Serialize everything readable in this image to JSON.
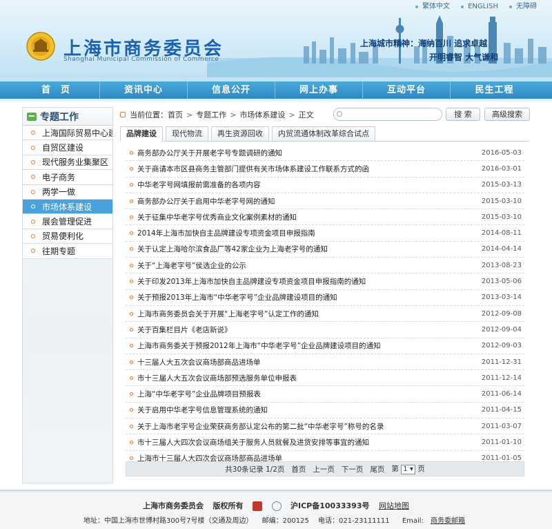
{
  "topbar": {
    "traditional": "繁体中文",
    "english": "ENGLISH",
    "accessibility": "无障碍"
  },
  "header": {
    "title": "上海市商务委员会",
    "subtitle": "Shanghai Municipal Commission of Commerce",
    "spirit_line1": "上海城市精神：海纳百川   追求卓越",
    "spirit_line2": "开明睿智   大气谦和"
  },
  "nav": [
    "首　页",
    "资讯中心",
    "信息公开",
    "网上办事",
    "互动平台",
    "民生工程"
  ],
  "sidebar": {
    "title": "专题工作",
    "items": [
      {
        "label": "上海国际贸易中心建设",
        "active": false
      },
      {
        "label": "自贸区建设",
        "active": false
      },
      {
        "label": "现代服务业集聚区",
        "active": false
      },
      {
        "label": "电子商务",
        "active": false
      },
      {
        "label": "两学一做",
        "active": false
      },
      {
        "label": "市场体系建设",
        "active": true
      },
      {
        "label": "展会管理促进",
        "active": false
      },
      {
        "label": "贸易便利化",
        "active": false
      },
      {
        "label": "往期专题",
        "active": false
      }
    ]
  },
  "breadcrumb": {
    "prefix": "当前位置：",
    "items": [
      "首页",
      "专题工作",
      "市场体系建设",
      "正文"
    ]
  },
  "search": {
    "placeholder": "",
    "button": "搜 索",
    "advanced": "高级搜索"
  },
  "tabs": [
    {
      "label": "品牌建设",
      "active": true
    },
    {
      "label": "现代物流",
      "active": false
    },
    {
      "label": "再生资源回收",
      "active": false
    },
    {
      "label": "内贸流通体制改革综合试点",
      "active": false
    }
  ],
  "articles": [
    {
      "title": "商务部办公厅关于开展老字号专题调研的通知",
      "date": "2016-05-03"
    },
    {
      "title": "关于商请本市区县商务主管部门提供有关市场体系建设工作联系方式的函",
      "date": "2016-03-01"
    },
    {
      "title": "中华老字号网填报前需准备的各项内容",
      "date": "2015-03-13"
    },
    {
      "title": "商务部办公厅关于启用中华老字号网的通知",
      "date": "2015-03-10"
    },
    {
      "title": "关于征集中华老字号优秀商业文化案例素材的通知",
      "date": "2015-03-10"
    },
    {
      "title": "2014年上海市加快自主品牌建设专项资金项目申报指南",
      "date": "2014-08-11"
    },
    {
      "title": "关于认定上海哈尔滨食品厂等42家企业为上海老字号的通知",
      "date": "2014-04-14"
    },
    {
      "title": "关于“上海老字号”侯选企业的公示",
      "date": "2013-08-23"
    },
    {
      "title": "关于印发2013年上海市加快自主品牌建设专项资金项目申报指南的通知",
      "date": "2013-05-06"
    },
    {
      "title": "关于预报2013年上海市“中华老字号”企业品牌建设项目的通知",
      "date": "2013-03-14"
    },
    {
      "title": "上海市商务委员会关于开展“上海老字号”认定工作的通知",
      "date": "2012-09-08"
    },
    {
      "title": "关于百集栏目片《老店新说》",
      "date": "2012-09-04"
    },
    {
      "title": "上海市商务委关于预报2012年上海市“中华老字号”企业品牌建设项目的通知",
      "date": "2012-09-03"
    },
    {
      "title": "十三届人大五次会议商场部商品进场单",
      "date": "2011-12-31"
    },
    {
      "title": "市十三届人大五次会议商场部预选服务单位申报表",
      "date": "2011-12-14"
    },
    {
      "title": "上海“中华老字号”企业品牌项目预报表",
      "date": "2011-06-14"
    },
    {
      "title": "关于启用中华老字号信息管理系统的通知",
      "date": "2011-04-15"
    },
    {
      "title": "关于上海市老字号企业荣获商务部认定公布的第二批“中华老字号”称号的名录",
      "date": "2011-03-07"
    },
    {
      "title": "市十三届人大四次会议商场组关于服务人员就餐及进货安排等事宜的通知",
      "date": "2011-01-10"
    },
    {
      "title": "上海市十三届人大四次会议商场部商品进场单",
      "date": "2011-01-05"
    }
  ],
  "pager": {
    "summary": "共30条记录 1/2页",
    "first": "首页",
    "prev": "上一页",
    "next": "下一页",
    "last": "尾页",
    "goto_prefix": "第",
    "current_page": "1",
    "goto_suffix": "页"
  },
  "footer": {
    "org": "上海市商务委员会",
    "copyright": "版权所有",
    "icp": "沪ICP备10033393号",
    "sitemap": "网站地图",
    "address": "地址：中国上海市世博村路300号7号楼（交通及周边）",
    "postcode": "邮编：200125",
    "phone": "电话：021-23111111",
    "email_label": "Email:",
    "email_link": "商务委邮箱"
  },
  "colors": {
    "nav": "#2d88c2",
    "active_sidebar": "#4aa2dc",
    "title_blue": "#1b62b0",
    "bullet_orange": "#e07a2f"
  }
}
